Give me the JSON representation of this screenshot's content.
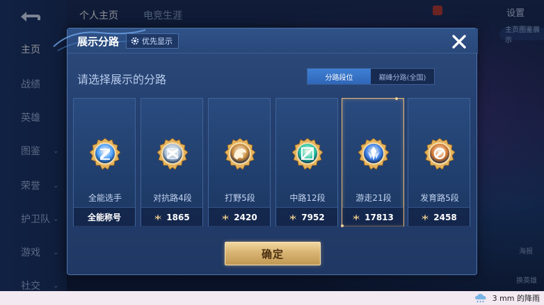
{
  "background": {
    "side_nav": [
      {
        "label": "主页",
        "active": true,
        "has_caret": false
      },
      {
        "label": "战绩",
        "active": false,
        "has_caret": false
      },
      {
        "label": "英雄",
        "active": false,
        "has_caret": false
      },
      {
        "label": "图鉴",
        "active": false,
        "has_caret": true
      },
      {
        "label": "荣誉",
        "active": false,
        "has_caret": true
      },
      {
        "label": "护卫队",
        "active": false,
        "has_caret": true
      },
      {
        "label": "游戏",
        "active": false,
        "has_caret": true
      },
      {
        "label": "社交",
        "active": false,
        "has_caret": true
      }
    ],
    "top_tabs": [
      "个人主页",
      "电竞生涯"
    ],
    "settings_label": "设置",
    "right_tab_label": "主页图鉴展示",
    "poster_label": "海报",
    "hero_label": "换英雄"
  },
  "modal": {
    "title": "展示分路",
    "priority_label": "优先显示",
    "prompt": "请选择展示的分路",
    "toggle_options": [
      {
        "label": "分路段位",
        "active": true
      },
      {
        "label": "巅峰分路(全国)",
        "active": false
      }
    ],
    "cards": [
      {
        "name": "全能选手",
        "footer": "全能称号",
        "has_points": false,
        "selected": false,
        "emblem": "all-round",
        "accent": "#4aa0ff"
      },
      {
        "name": "对抗路4段",
        "footer": "1865",
        "has_points": true,
        "selected": false,
        "emblem": "clash-lane",
        "accent": "#a9bfd6"
      },
      {
        "name": "打野5段",
        "footer": "2420",
        "has_points": true,
        "selected": false,
        "emblem": "jungle",
        "accent": "#c98a3c"
      },
      {
        "name": "中路12段",
        "footer": "7952",
        "has_points": true,
        "selected": false,
        "emblem": "mid-lane",
        "accent": "#2bc9a6"
      },
      {
        "name": "游走21段",
        "footer": "17813",
        "has_points": true,
        "selected": true,
        "emblem": "roam",
        "accent": "#3b7fe8"
      },
      {
        "name": "发育路5段",
        "footer": "2458",
        "has_points": true,
        "selected": false,
        "emblem": "farm-lane",
        "accent": "#d47a34"
      }
    ],
    "confirm_label": "确定"
  },
  "weather": {
    "text": "3 mm 的降雨",
    "icon": "rain-cloud-icon"
  }
}
